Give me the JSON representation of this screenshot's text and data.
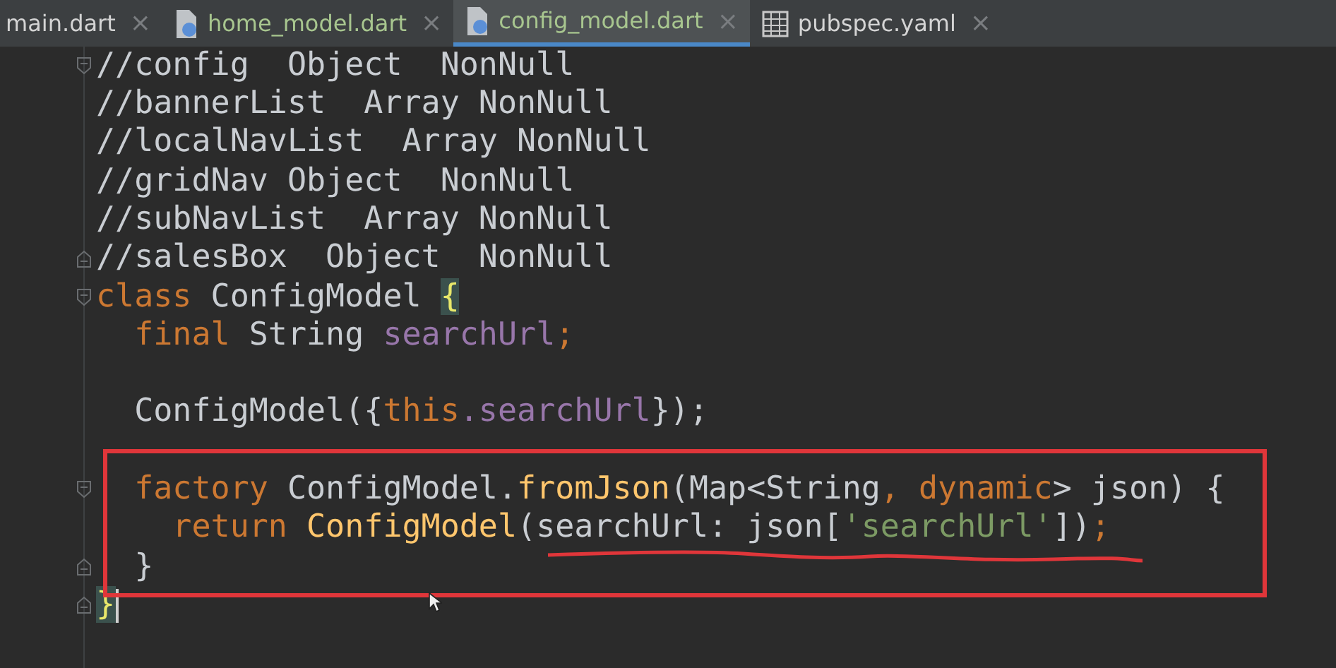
{
  "tabs": [
    {
      "label": "main.dart",
      "kind": "none",
      "color": "#d4d4d4",
      "selected": false
    },
    {
      "label": "home_model.dart",
      "kind": "dart",
      "color": "#a8c68f",
      "selected": false
    },
    {
      "label": "config_model.dart",
      "kind": "dart",
      "color": "#a8c68f",
      "selected": true
    },
    {
      "label": "pubspec.yaml",
      "kind": "table",
      "color": "#d4d4d4",
      "selected": false
    }
  ],
  "close_glyph": "×",
  "code_lines": [
    {
      "fold_open": true,
      "fold_close": false,
      "caret": false,
      "tokens": [
        {
          "t": "//config  Object  NonNull",
          "kind": "plain"
        }
      ]
    },
    {
      "fold_open": false,
      "fold_close": false,
      "caret": false,
      "tokens": [
        {
          "t": "//bannerList  Array NonNull",
          "kind": "plain"
        }
      ]
    },
    {
      "fold_open": false,
      "fold_close": false,
      "caret": false,
      "tokens": [
        {
          "t": "//localNavList  Array NonNull",
          "kind": "plain"
        }
      ]
    },
    {
      "fold_open": false,
      "fold_close": false,
      "caret": false,
      "tokens": [
        {
          "t": "//gridNav Object  NonNull",
          "kind": "plain"
        }
      ]
    },
    {
      "fold_open": false,
      "fold_close": false,
      "caret": false,
      "tokens": [
        {
          "t": "//subNavList  Array NonNull",
          "kind": "plain"
        }
      ]
    },
    {
      "fold_open": false,
      "fold_close": true,
      "caret": false,
      "tokens": [
        {
          "t": "//salesBox  Object  NonNull",
          "kind": "plain"
        }
      ]
    },
    {
      "fold_open": true,
      "fold_close": false,
      "caret": false,
      "tokens": [
        {
          "t": "class",
          "kind": "keyword"
        },
        {
          "t": " ConfigModel ",
          "kind": "plain"
        },
        {
          "t": "{",
          "kind": "brace"
        }
      ]
    },
    {
      "fold_open": false,
      "fold_close": false,
      "caret": false,
      "tokens": [
        {
          "t": "  final",
          "kind": "keyword"
        },
        {
          "t": " String ",
          "kind": "plain"
        },
        {
          "t": "searchUrl",
          "kind": "field"
        },
        {
          "t": ";",
          "kind": "keyword"
        }
      ]
    },
    {
      "fold_open": false,
      "fold_close": false,
      "caret": false
    },
    {
      "fold_open": false,
      "fold_close": false,
      "caret": false,
      "tokens": [
        {
          "t": "  ConfigModel({",
          "kind": "plain"
        },
        {
          "t": "this",
          "kind": "keyword"
        },
        {
          "t": ".searchUrl",
          "kind": "field"
        },
        {
          "t": "});",
          "kind": "plain"
        }
      ]
    },
    {
      "fold_open": false,
      "fold_close": false,
      "caret": false
    },
    {
      "fold_open": true,
      "fold_close": false,
      "caret": false,
      "tokens": [
        {
          "t": "  factory",
          "kind": "keyword"
        },
        {
          "t": " ConfigModel.",
          "kind": "plain"
        },
        {
          "t": "fromJson",
          "kind": "method"
        },
        {
          "t": "(Map<String",
          "kind": "plain"
        },
        {
          "t": ",",
          "kind": "keyword"
        },
        {
          "t": " dynamic",
          "kind": "keyword"
        },
        {
          "t": "> json) {",
          "kind": "plain"
        }
      ]
    },
    {
      "fold_open": false,
      "fold_close": false,
      "caret": false,
      "tokens": [
        {
          "t": "    return",
          "kind": "keyword"
        },
        {
          "t": " ConfigModel",
          "kind": "method"
        },
        {
          "t": "(searchUrl: json[",
          "kind": "plain"
        },
        {
          "t": "'searchUrl'",
          "kind": "string"
        },
        {
          "t": "])",
          "kind": "plain"
        },
        {
          "t": ";",
          "kind": "keyword"
        }
      ]
    },
    {
      "fold_open": false,
      "fold_close": true,
      "caret": false,
      "tokens": [
        {
          "t": "  }",
          "kind": "plain"
        }
      ]
    },
    {
      "fold_open": false,
      "fold_close": true,
      "caret": true,
      "tokens": [
        {
          "t": "}",
          "kind": "brace"
        }
      ]
    }
  ]
}
